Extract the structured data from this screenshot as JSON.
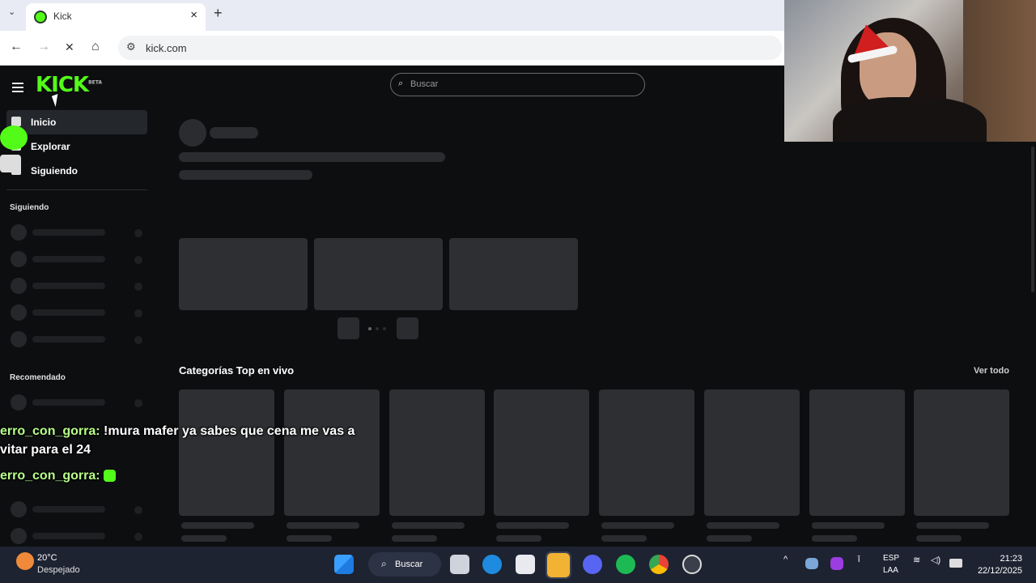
{
  "browser": {
    "tab_title": "Kick",
    "close_glyph": "×",
    "new_tab_glyph": "+",
    "dropdown_glyph": "⌄",
    "back_glyph": "←",
    "forward_glyph": "→",
    "stop_glyph": "✕",
    "home_glyph": "⌂",
    "site_settings_glyph": "⚙",
    "url": "kick.com"
  },
  "kick": {
    "logo": "KICK",
    "logo_badge": "BETA",
    "search_icon": "⌕",
    "search_placeholder": "Buscar",
    "nav": [
      {
        "label": "Inicio",
        "icon": "home-icon"
      },
      {
        "label": "Explorar",
        "icon": "compass-icon"
      },
      {
        "label": "Siguiendo",
        "icon": "heart-icon"
      }
    ],
    "following_title": "Siguiendo",
    "recommended_title": "Recomendado",
    "categories_title": "Categorías Top en vivo",
    "see_all": "Ver todo",
    "accent_color": "#53fc18"
  },
  "chat_overlay": [
    {
      "user": "erro_con_gorra:",
      "message": " !mura mafer ya sabes que cena me vas a"
    },
    {
      "user": "",
      "message": "vitar para el 24"
    },
    {
      "user": "erro_con_gorra:",
      "message": " "
    }
  ],
  "taskbar": {
    "temperature": "20°C",
    "condition": "Despejado",
    "search_label": "Buscar",
    "search_icon": "⌕",
    "lang_line1": "ESP",
    "lang_line2": "LAA",
    "time": "21:23",
    "date": "22/12/2025",
    "tray_up_glyph": "^",
    "wifi_glyph": "≋",
    "volume_glyph": "◁)",
    "mic_glyph": "ǐ"
  }
}
